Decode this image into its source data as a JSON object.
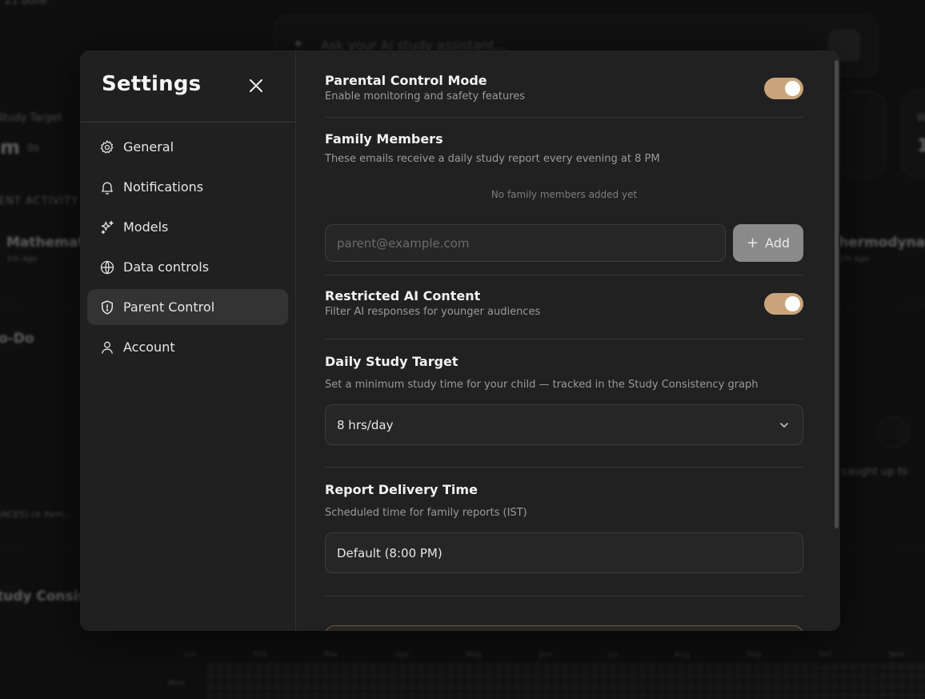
{
  "background": {
    "ask_placeholder": "Ask your AI study assistant...",
    "top_left_text": "21 done",
    "study_target_label": "Study Target",
    "study_target_value": "m",
    "study_target_unit": "0s",
    "recent_activity_label": "ENT ACTIVITY",
    "activity_left": "Mathemati",
    "activity_left_sub": "1m ago",
    "activity_right": "hermodynam",
    "activity_right_sub": "1m ago",
    "todo_label": "o-Do",
    "caught_up": "caught up fo",
    "items_hint": "(ACES) ck item...",
    "consistency_label": "tudy Consis",
    "months": [
      "Jan",
      "Feb",
      "Mar",
      "Apr",
      "May",
      "Jun",
      "Jul",
      "Aug",
      "Sep",
      "Oct",
      "Nov"
    ],
    "weekday": "Mon",
    "right_stat_label": "W",
    "right_stat_value": "1"
  },
  "sidebar": {
    "title": "Settings",
    "items": [
      {
        "label": "General",
        "icon": "gear-icon"
      },
      {
        "label": "Notifications",
        "icon": "bell-icon"
      },
      {
        "label": "Models",
        "icon": "sparkles-icon"
      },
      {
        "label": "Data controls",
        "icon": "globe-icon"
      },
      {
        "label": "Parent Control",
        "icon": "shield-alert-icon",
        "active": true
      },
      {
        "label": "Account",
        "icon": "user-icon"
      }
    ]
  },
  "parental_mode": {
    "title": "Parental Control Mode",
    "subtitle": "Enable monitoring and safety features",
    "enabled": true
  },
  "family": {
    "title": "Family Members",
    "subtitle": "These emails receive a daily study report every evening at 8 PM",
    "empty_text": "No family members added yet",
    "email_placeholder": "parent@example.com",
    "add_label": "Add"
  },
  "restricted": {
    "title": "Restricted AI Content",
    "subtitle": "Filter AI responses for younger audiences",
    "enabled": true
  },
  "study_target": {
    "title": "Daily Study Target",
    "subtitle": "Set a minimum study time for your child — tracked in the Study Consistency graph",
    "value": "8 hrs/day"
  },
  "report_time": {
    "title": "Report Delivery Time",
    "subtitle": "Scheduled time for family reports (IST)",
    "value": "Default (8:00 PM)"
  },
  "colors": {
    "accent": "#c9a47b",
    "modal_bg": "#212121",
    "page_bg": "#0f0f0f"
  }
}
